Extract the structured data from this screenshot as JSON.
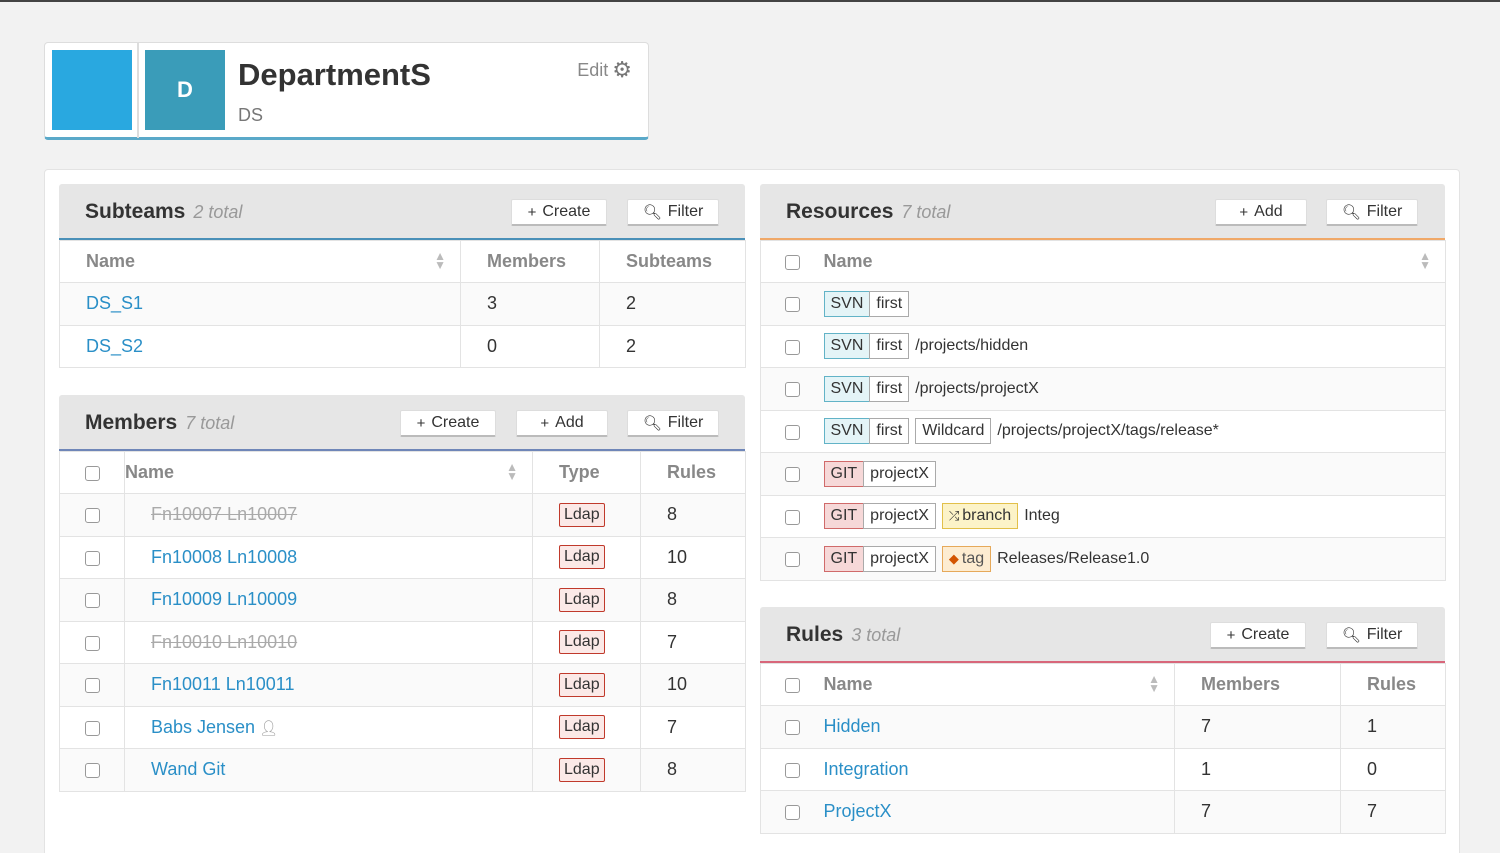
{
  "team": {
    "avatar_letter": "D",
    "name": "DepartmentS",
    "code": "DS",
    "edit_label": "Edit",
    "color": "#29a8e0"
  },
  "subteams": {
    "title": "Subteams",
    "count": "2 total",
    "create_label": "Create",
    "filter_label": "Filter",
    "columns": [
      "Name",
      "Members",
      "Subteams"
    ],
    "rows": [
      {
        "name": "DS_S1",
        "members": "3",
        "subteams": "2"
      },
      {
        "name": "DS_S2",
        "members": "0",
        "subteams": "2"
      }
    ]
  },
  "members": {
    "title": "Members",
    "count": "7 total",
    "create_label": "Create",
    "add_label": "Add",
    "filter_label": "Filter",
    "columns": [
      "Name",
      "Type",
      "Rules"
    ],
    "rows": [
      {
        "name": "Fn10007 Ln10007",
        "type": "Ldap",
        "rules": "8"
      },
      {
        "name": "Fn10008 Ln10008",
        "type": "Ldap",
        "rules": "10"
      },
      {
        "name": "Fn10009 Ln10009",
        "type": "Ldap",
        "rules": "8"
      },
      {
        "name": "Fn10010 Ln10010",
        "type": "Ldap",
        "rules": "7"
      },
      {
        "name": "Fn10011 Ln10011",
        "type": "Ldap",
        "rules": "10"
      },
      {
        "name": "Babs Jensen",
        "type": "Ldap",
        "rules": "7"
      },
      {
        "name": "Wand Git",
        "type": "Ldap",
        "rules": "8"
      }
    ]
  },
  "resources": {
    "title": "Resources",
    "count": "7 total",
    "add_label": "Add",
    "filter_label": "Filter",
    "columns": [
      "Name"
    ],
    "rows": [
      {
        "vcs": "SVN",
        "repo": "first",
        "path": ""
      },
      {
        "vcs": "SVN",
        "repo": "first",
        "path": "/projects/hidden"
      },
      {
        "vcs": "SVN",
        "repo": "first",
        "path": "/projects/projectX"
      },
      {
        "vcs": "SVN",
        "repo": "first",
        "extra": "Wildcard",
        "path": "/projects/projectX/tags/release*"
      },
      {
        "vcs": "GIT",
        "repo": "projectX",
        "path": ""
      },
      {
        "vcs": "GIT",
        "repo": "projectX",
        "extra": "branch",
        "path": "Integ"
      },
      {
        "vcs": "GIT",
        "repo": "projectX",
        "extra": "tag",
        "path": "Releases/Release1.0"
      }
    ]
  },
  "rules": {
    "title": "Rules",
    "count": "3 total",
    "create_label": "Create",
    "filter_label": "Filter",
    "columns": [
      "Name",
      "Members",
      "Rules"
    ],
    "rows": [
      {
        "name": "Hidden",
        "members": "7",
        "rules": "1"
      },
      {
        "name": "Integration",
        "members": "1",
        "rules": "0"
      },
      {
        "name": "ProjectX",
        "members": "7",
        "rules": "7"
      }
    ]
  },
  "colors": {
    "subteams_accent": "#4a90b8",
    "members_accent": "#6f86b8",
    "resources_accent": "#f0a868",
    "rules_accent": "#d8667a"
  }
}
